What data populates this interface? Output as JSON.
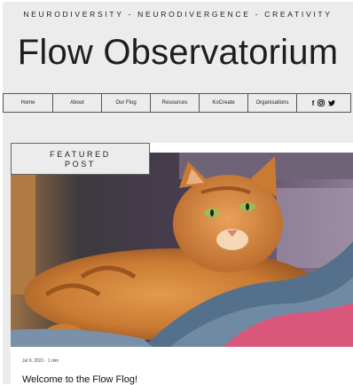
{
  "header": {
    "tagline": "NEURODIVERSITY - NEURODIVERGENCE - CREATIVITY",
    "site_title": "Flow Observatorium"
  },
  "nav": {
    "items": [
      {
        "label": "Home"
      },
      {
        "label": "About"
      },
      {
        "label": "Our Flog"
      },
      {
        "label": "Resources"
      },
      {
        "label": "KoCreate"
      },
      {
        "label": "Organisations"
      }
    ],
    "social": [
      "facebook-icon",
      "instagram-icon",
      "twitter-icon"
    ]
  },
  "featured_post": {
    "badge_line1": "FEATURED",
    "badge_line2": "POST",
    "image": "orange-tabby-cat-photo",
    "date": "Jul 9, 2021",
    "read_time": "1 min",
    "title": "Welcome to the Flow Flog!"
  },
  "colors": {
    "page_bg": "#ececec",
    "text": "#1e1e1e",
    "border": "#555555"
  }
}
